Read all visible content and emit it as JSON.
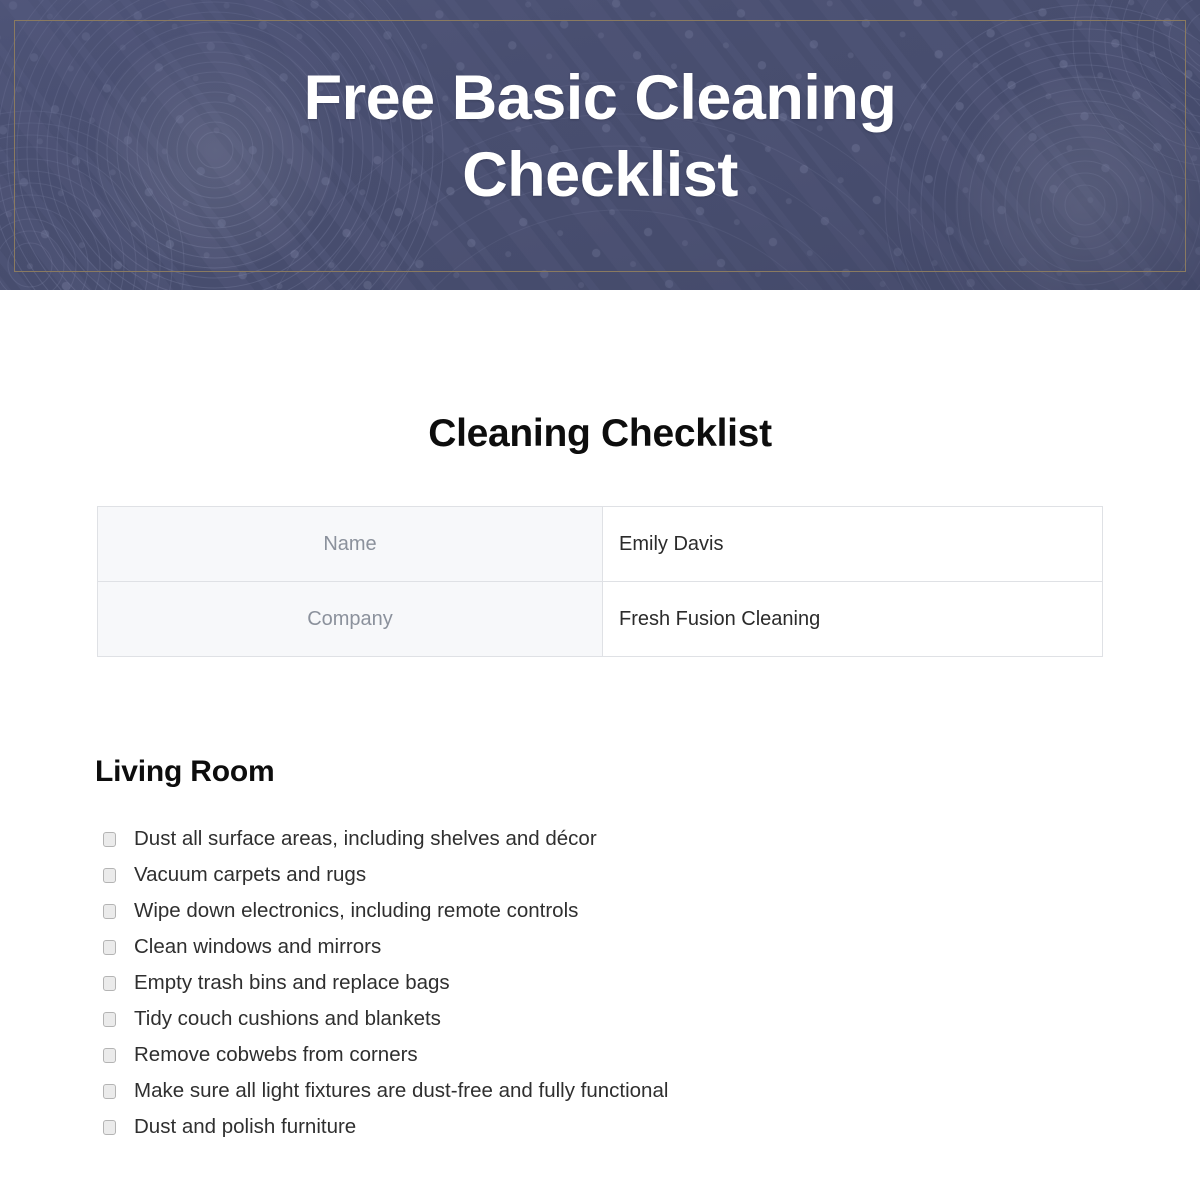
{
  "banner": {
    "title": "Free Basic Cleaning\nChecklist",
    "background_color": "#474d6e",
    "border_color": "#8a7a60",
    "title_color": "#ffffff"
  },
  "document": {
    "title": "Cleaning Checklist",
    "info_table": {
      "rows": [
        {
          "label": "Name",
          "value": "Emily Davis"
        },
        {
          "label": "Company",
          "value": "Fresh Fusion Cleaning"
        }
      ]
    },
    "sections": [
      {
        "heading": "Living Room",
        "items": [
          {
            "label": "Dust all surface areas, including shelves and décor",
            "checked": false
          },
          {
            "label": "Vacuum carpets and rugs",
            "checked": false
          },
          {
            "label": "Wipe down electronics, including remote controls",
            "checked": false
          },
          {
            "label": "Clean windows and mirrors",
            "checked": false
          },
          {
            "label": "Empty trash bins and replace bags",
            "checked": false
          },
          {
            "label": "Tidy couch cushions and blankets",
            "checked": false
          },
          {
            "label": "Remove cobwebs from corners",
            "checked": false
          },
          {
            "label": "Make sure all light fixtures are dust-free and fully functional",
            "checked": false
          },
          {
            "label": "Dust and polish furniture",
            "checked": false
          }
        ]
      }
    ]
  },
  "colors": {
    "label_cell_bg": "#f7f8fa",
    "label_text": "#8b919c",
    "value_text": "#2b2b2b",
    "table_border": "#dfe1e5",
    "checkbox_fill": "#ebebeb",
    "checkbox_border": "#b4b4b4"
  }
}
